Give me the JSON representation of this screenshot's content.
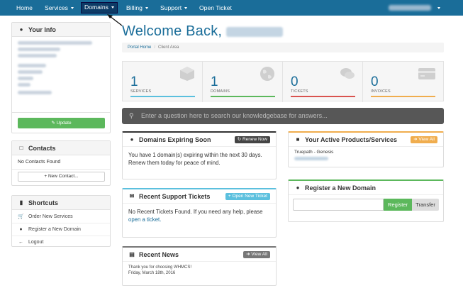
{
  "nav": {
    "home": "Home",
    "services": "Services",
    "domains": "Domains",
    "billing": "Billing",
    "support": "Support",
    "open_ticket": "Open Ticket"
  },
  "welcome": "Welcome Back,",
  "breadcrumb": {
    "home": "Portal Home",
    "current": "Client Area"
  },
  "sidebar": {
    "your_info": {
      "title": "Your Info",
      "update_label": "Update"
    },
    "contacts": {
      "title": "Contacts",
      "empty": "No Contacts Found",
      "new_label": "New Contact..."
    },
    "shortcuts": {
      "title": "Shortcuts",
      "items": [
        {
          "label": "Order New Services",
          "icon": "cart-icon"
        },
        {
          "label": "Register a New Domain",
          "icon": "globe-icon"
        },
        {
          "label": "Logout",
          "icon": "arrow-left-icon"
        }
      ]
    }
  },
  "stats": [
    {
      "count": "1",
      "label": "SERVICES",
      "color": "#5bc0de",
      "icon": "cube-icon"
    },
    {
      "count": "1",
      "label": "DOMAINS",
      "color": "#5cb85c",
      "icon": "globe-icon"
    },
    {
      "count": "0",
      "label": "TICKETS",
      "color": "#d9534f",
      "icon": "comments-icon"
    },
    {
      "count": "0",
      "label": "INVOICES",
      "color": "#f0ad4e",
      "icon": "credit-card-icon"
    }
  ],
  "kb_search": {
    "placeholder": "Enter a question here to search our knowledgebase for answers..."
  },
  "domains_expiring": {
    "title": "Domains Expiring Soon",
    "button": "Renew Now",
    "text": "You have 1 domain(s) expiring within the next 30 days. Renew them today for peace of mind."
  },
  "support_tickets": {
    "title": "Recent Support Tickets",
    "button": "Open New Ticket",
    "text": "No Recent Tickets Found. If you need any help, please",
    "link": "open a ticket."
  },
  "recent_news": {
    "title": "Recent News",
    "button": "View All",
    "item_title": "Thank you for choosing WHMCS!",
    "item_date": "Friday, March 18th, 2016"
  },
  "products": {
    "title": "Your Active Products/Services",
    "button": "View All",
    "item": "Truepath - Genesis"
  },
  "register_domain": {
    "title": "Register a New Domain",
    "register": "Register",
    "transfer": "Transfer"
  },
  "colors": {
    "navbar": "#1a6d99",
    "primary": "#1a6d99",
    "success": "#5cb85c",
    "info": "#5bc0de",
    "danger": "#d9534f",
    "warning": "#f0ad4e"
  }
}
